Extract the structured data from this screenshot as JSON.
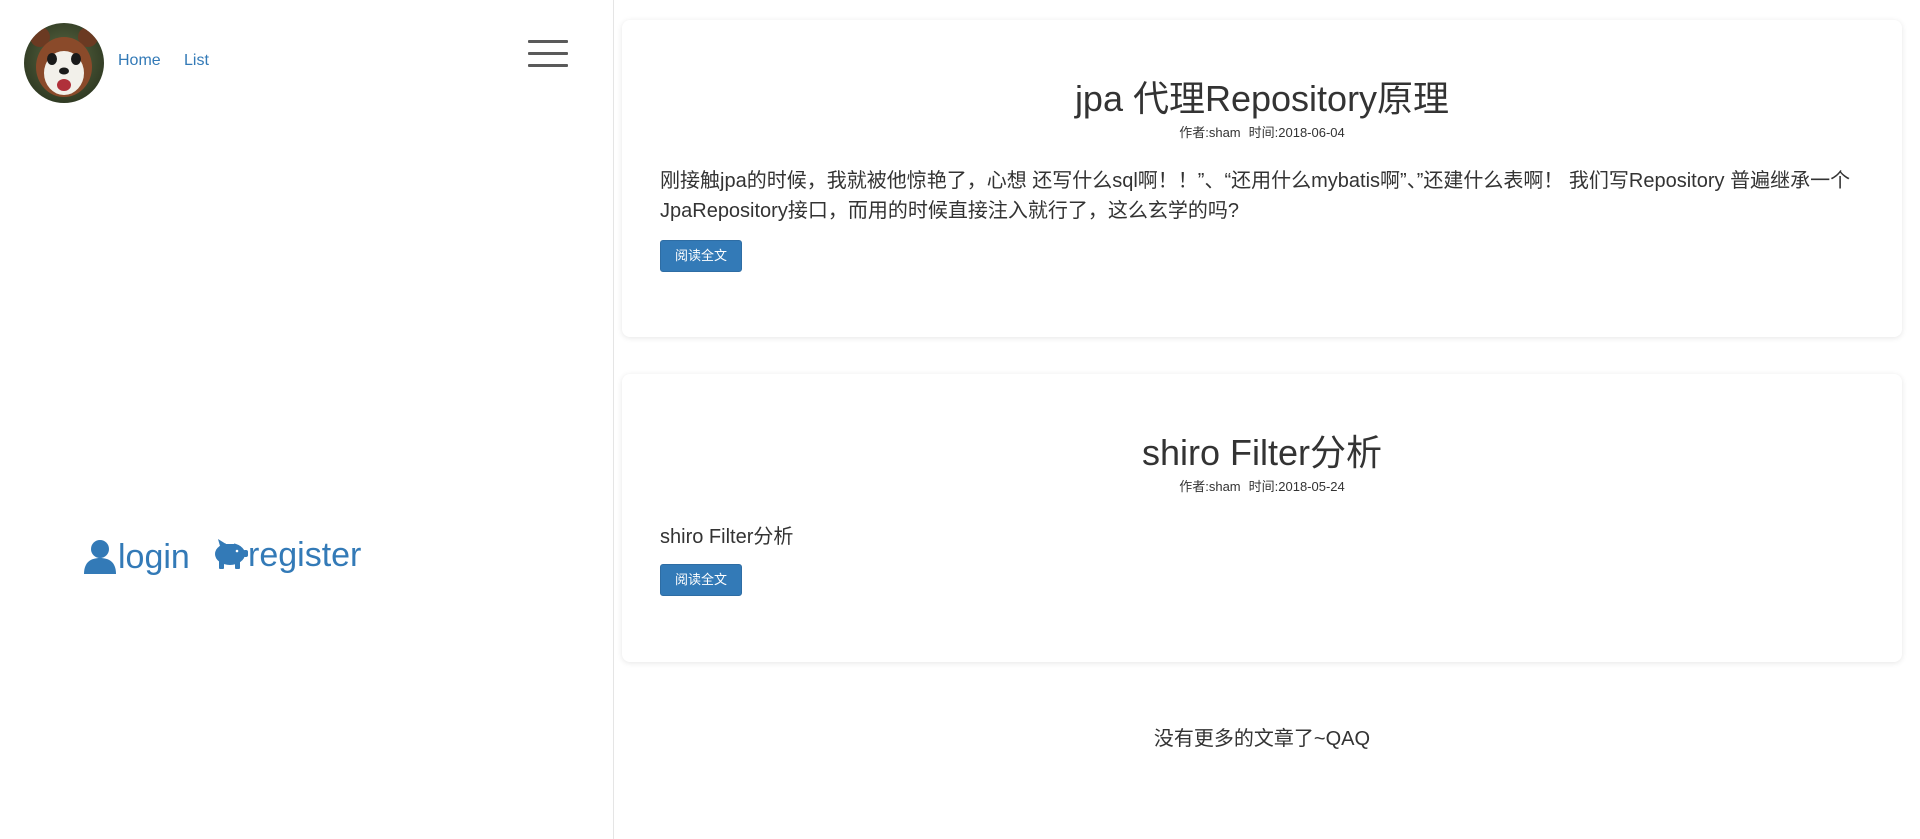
{
  "nav": {
    "home_label": "Home",
    "list_label": "List"
  },
  "auth": {
    "login_label": "login",
    "register_label": "register"
  },
  "colors": {
    "link": "#337ab7",
    "button": "#337ab7"
  },
  "posts": [
    {
      "title": "jpa 代理Repository原理",
      "author": "作者:sham",
      "date": "时间:2018-06-04",
      "summary": "刚接触jpa的时候，我就被他惊艳了，心想 还写什么sql啊！！”、“还用什么mybatis啊”、”还建什么表啊！ 我们写Repository 普遍继承一个JpaRepository接口，而用的时候直接注入就行了，这么玄学的吗?",
      "read_more_label": "阅读全文"
    },
    {
      "title": "shiro Filter分析",
      "author": "作者:sham",
      "date": "时间:2018-05-24",
      "summary": "shiro Filter分析",
      "read_more_label": "阅读全文"
    }
  ],
  "footer_note": "没有更多的文章了~QAQ",
  "icons": {
    "hamburger": "menu-icon",
    "login": "user-icon",
    "register": "piggy-bank-icon"
  }
}
